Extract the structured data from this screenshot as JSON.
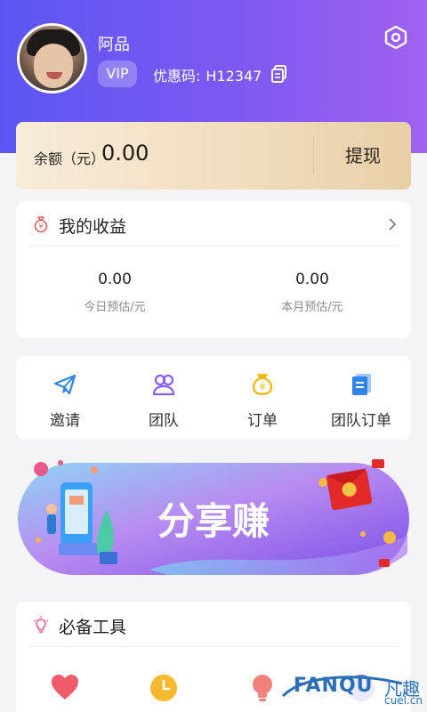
{
  "profile": {
    "username": "阿品",
    "badge": "VIP",
    "promo_label": "优惠码:",
    "promo_code": "H12347"
  },
  "balance": {
    "label": "余额（元）",
    "value": "0.00",
    "withdraw": "提现"
  },
  "earnings": {
    "title": "我的收益",
    "today_value": "0.00",
    "today_caption": "今日预估/元",
    "month_value": "0.00",
    "month_caption": "本月预估/元"
  },
  "nav": {
    "items": [
      {
        "label": "邀请",
        "icon": "paper-plane-icon",
        "color": "#2f86e6"
      },
      {
        "label": "团队",
        "icon": "team-icon",
        "color": "#8a5cf0"
      },
      {
        "label": "订单",
        "icon": "money-bag-icon",
        "color": "#f4b400"
      },
      {
        "label": "团队订单",
        "icon": "document-icon",
        "color": "#2f86e6"
      }
    ]
  },
  "banner": {
    "text": "分享赚"
  },
  "tools": {
    "title": "必备工具"
  },
  "watermark": {
    "brand": "FANQU",
    "cn": "凡趣",
    "url": "cuel.cn"
  },
  "colors": {
    "header_start": "#5b56f2",
    "header_end": "#a062f0",
    "balance_gold": "#f0dcbd",
    "accent_purple": "#8a5cf0"
  }
}
